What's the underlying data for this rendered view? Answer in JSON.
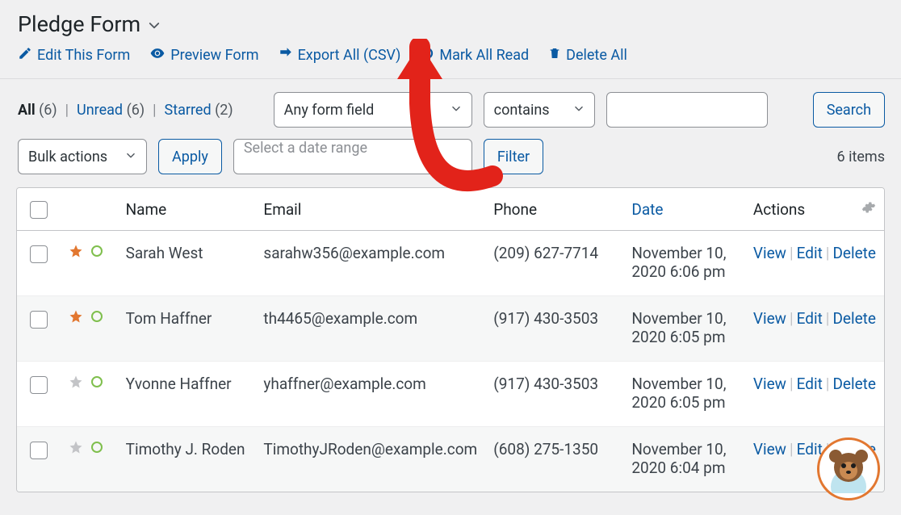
{
  "page": {
    "title": "Pledge Form"
  },
  "toolbar": {
    "edit": "Edit This Form",
    "preview": "Preview Form",
    "export": "Export All (CSV)",
    "mark": "Mark All Read",
    "delete": "Delete All"
  },
  "filters": {
    "all_label": "All",
    "all_count": "(6)",
    "unread_label": "Unread",
    "unread_count": "(6)",
    "starred_label": "Starred",
    "starred_count": "(2)",
    "field_select": "Any form field",
    "op_select": "contains",
    "search_button": "Search"
  },
  "nav2": {
    "bulk": "Bulk actions",
    "apply": "Apply",
    "date_placeholder": "Select a date range",
    "filter": "Filter",
    "items": "6 items"
  },
  "columns": {
    "name": "Name",
    "email": "Email",
    "phone": "Phone",
    "date": "Date",
    "actions": "Actions"
  },
  "actions": {
    "view": "View",
    "edit": "Edit",
    "delete": "Delete"
  },
  "rows": [
    {
      "name": "Sarah West",
      "email": "sarahw356@example.com",
      "phone": "(209) 627-7714",
      "date": "November 10, 2020 6:06 pm",
      "starred": true
    },
    {
      "name": "Tom Haffner",
      "email": "th4465@example.com",
      "phone": "(917) 430-3503",
      "date": "November 10, 2020 6:05 pm",
      "starred": true
    },
    {
      "name": "Yvonne Haffner",
      "email": "yhaffner@example.com",
      "phone": "(917) 430-3503",
      "date": "November 10, 2020 6:05 pm",
      "starred": false
    },
    {
      "name": "Timothy J. Roden",
      "email": "TimothyJRoden@example.com",
      "phone": "(608) 275-1350",
      "date": "November 10, 2020 6:04 pm",
      "starred": false
    }
  ]
}
